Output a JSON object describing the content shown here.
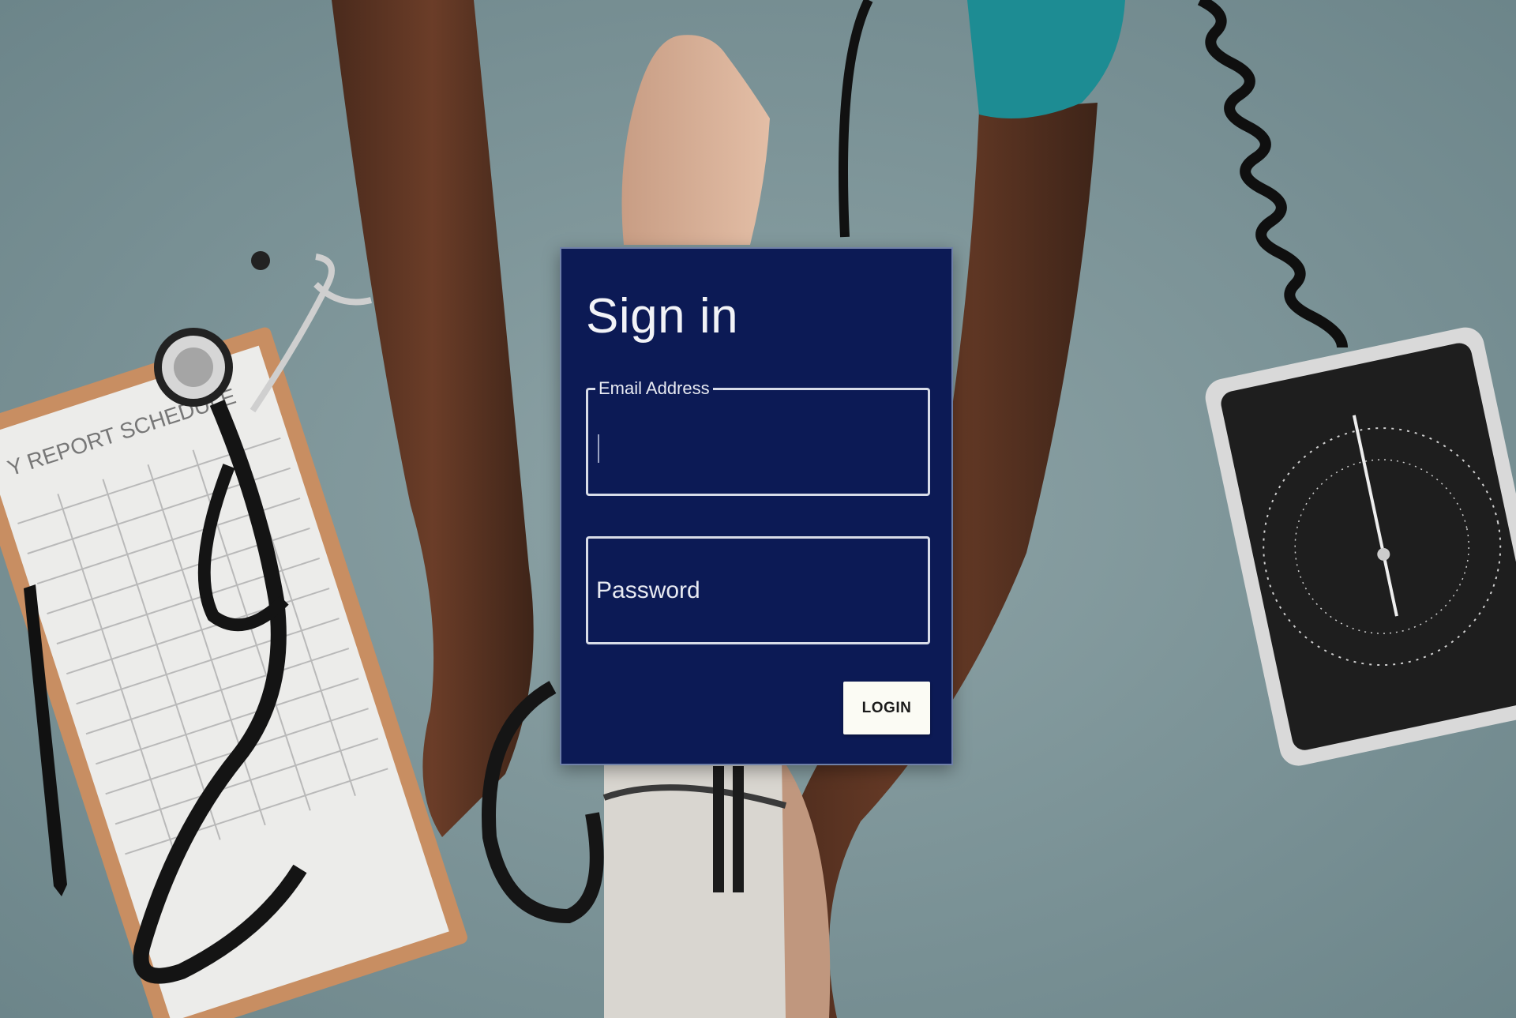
{
  "signin": {
    "title": "Sign in",
    "email": {
      "label": "Email Address",
      "value": "",
      "placeholder": ""
    },
    "password": {
      "placeholder": "Password",
      "value": ""
    },
    "login_label": "LOGIN"
  },
  "background": {
    "clipboard_text": "Y REPORT SCHEDULE"
  },
  "colors": {
    "card_bg": "#0c1a55",
    "button_bg": "#fbfbf4",
    "page_bg": "#7b9296"
  }
}
